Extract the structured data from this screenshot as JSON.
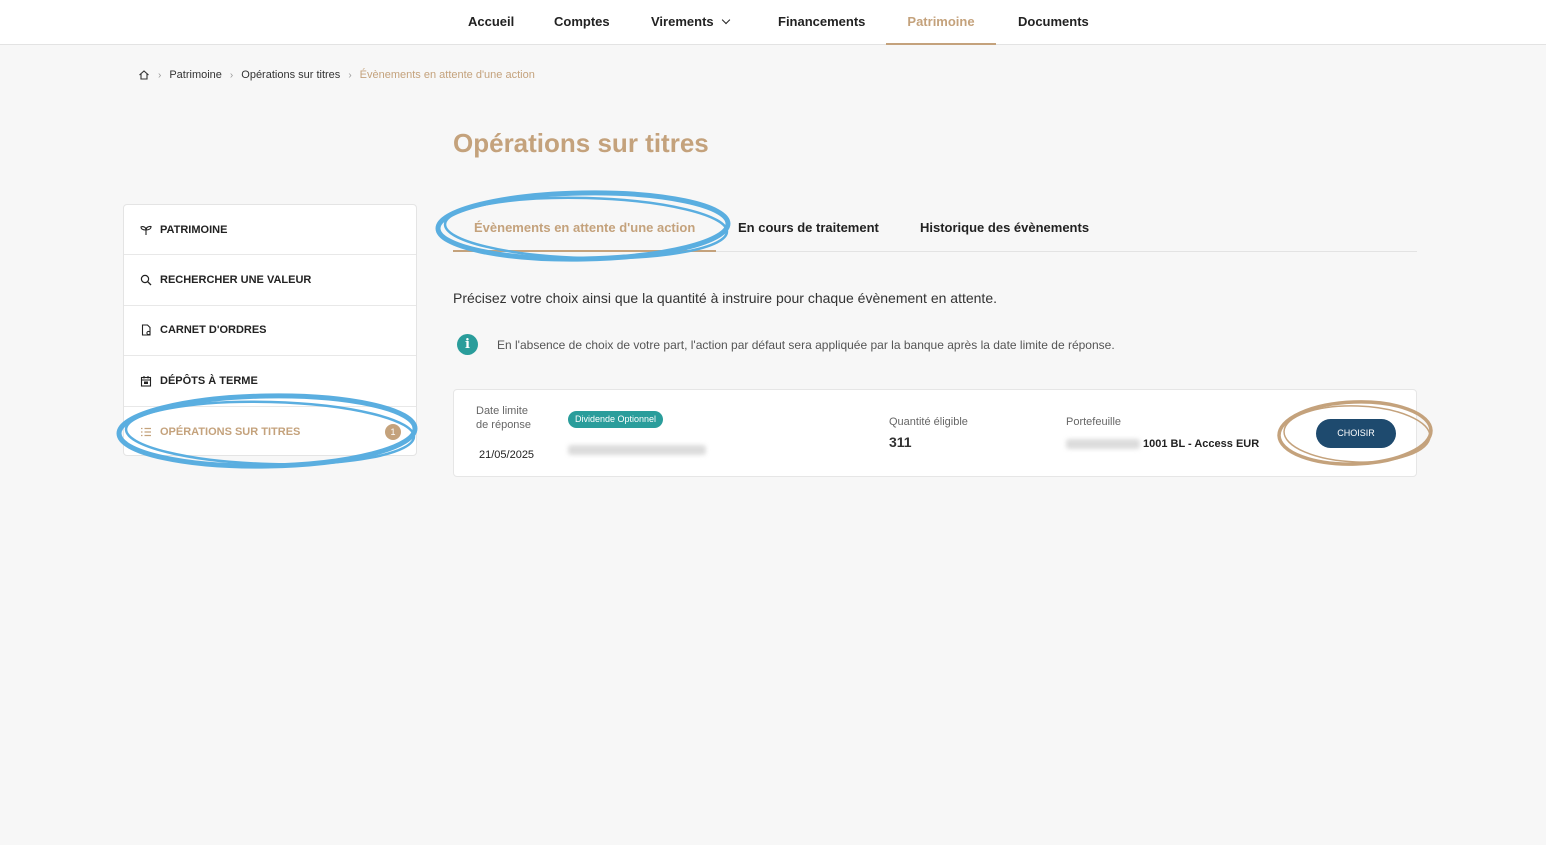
{
  "topnav": {
    "items": [
      {
        "label": "Accueil"
      },
      {
        "label": "Comptes"
      },
      {
        "label": "Virements"
      },
      {
        "label": "Financements"
      },
      {
        "label": "Patrimoine"
      },
      {
        "label": "Documents"
      }
    ]
  },
  "breadcrumb": {
    "items": [
      "Patrimoine",
      "Opérations sur titres"
    ],
    "current": "Évènements en attente d'une action"
  },
  "page": {
    "title": "Opérations sur titres"
  },
  "sidebar": {
    "items": [
      {
        "label": "PATRIMOINE",
        "icon": "sprout-icon"
      },
      {
        "label": "RECHERCHER UNE VALEUR",
        "icon": "search-icon"
      },
      {
        "label": "CARNET D'ORDRES",
        "icon": "document-icon"
      },
      {
        "label": "DÉPÔTS À TERME",
        "icon": "calendar-icon"
      },
      {
        "label": "OPÉRATIONS SUR TITRES",
        "icon": "list-icon",
        "badge": "1"
      }
    ]
  },
  "tabs": [
    {
      "label": "Évènements en attente d'une action"
    },
    {
      "label": "En cours de traitement"
    },
    {
      "label": "Historique des évènements"
    }
  ],
  "intro": "Précisez votre choix ainsi que la quantité à instruire pour chaque évènement en attente.",
  "info": "En l'absence de choix de votre part, l'action par défaut sera appliquée par la banque après la date limite de réponse.",
  "event": {
    "deadline_label_1": "Date limite",
    "deadline_label_2": "de réponse",
    "deadline_value": "21/05/2025",
    "type_tag": "Dividende Optionnel",
    "qty_label": "Quantité éligible",
    "qty_value": "311",
    "portfolio_label": "Portefeuille",
    "portfolio_name": "1001 BL - Access EUR",
    "action_label": "CHOISIR"
  },
  "colors": {
    "accent": "#c4a27c",
    "teal": "#2a9d9b",
    "button": "#1e4a6e",
    "annotation_blue": "#5aaee0",
    "annotation_gold": "#c4a27c"
  }
}
